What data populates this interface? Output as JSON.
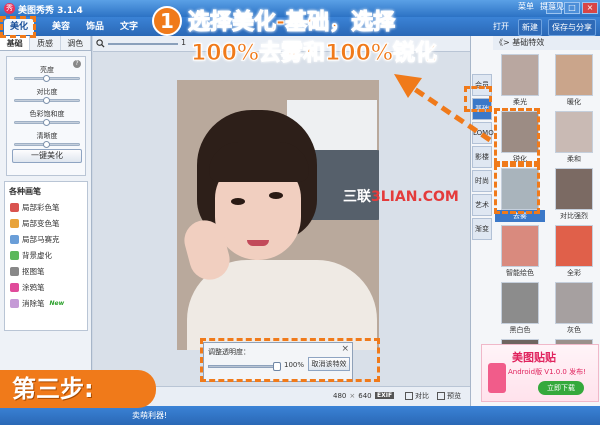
{
  "app": {
    "title": "美图秀秀 3.1.4",
    "logo_char": "秀"
  },
  "window_controls": [
    "–",
    "□",
    "×"
  ],
  "main_tabs": [
    "美化",
    "美容",
    "饰品",
    "文字"
  ],
  "toolbar_right": {
    "menu": "菜单",
    "feedback": "提意见",
    "open": "打开",
    "new": "新建",
    "save_share": "保存与分享"
  },
  "left_panel": {
    "subtabs": [
      "基础",
      "质感",
      "调色"
    ],
    "sliders": [
      "亮度",
      "对比度",
      "色彩饱和度",
      "清晰度"
    ],
    "one_key_button": "一键美化",
    "brush_title": "各种画笔",
    "brushes": [
      {
        "label": "局部彩色笔",
        "icon": "color-brush-icon",
        "color": "#d9534f"
      },
      {
        "label": "局部变色笔",
        "icon": "change-color-brush-icon",
        "color": "#e8a33b"
      },
      {
        "label": "局部马赛克",
        "icon": "mosaic-icon",
        "color": "#6a9ed8"
      },
      {
        "label": "背景虚化",
        "icon": "blur-icon",
        "color": "#5cb85c"
      },
      {
        "label": "抠图笔",
        "icon": "cutout-icon",
        "color": "#888888"
      },
      {
        "label": "涂鸦笔",
        "icon": "doodle-icon",
        "color": "#e04b9a"
      },
      {
        "label": "消除笔",
        "icon": "eraser-icon",
        "color": "#c59ad6",
        "badge": "New"
      }
    ]
  },
  "canvas": {
    "zoom_value": "1",
    "watermark_a": "三联",
    "watermark_b": "3LIAN.COM",
    "opacity_panel": {
      "label": "调整透明度：",
      "value": "100%",
      "cancel_button": "取消该特效",
      "close": "×"
    },
    "width": "480",
    "x": "×",
    "height": "640",
    "exif": "EXIF",
    "compare": "对比",
    "preview": "预览"
  },
  "right_panel": {
    "header": "《> 基础特效",
    "categories": [
      "会员",
      "基础",
      "LOMO",
      "影楼",
      "时尚",
      "艺术",
      "渐变"
    ],
    "active_category": "基础",
    "effects": [
      {
        "name": "柔光",
        "color": "#b9a7a0"
      },
      {
        "name": "暖化",
        "color": "#caa58b"
      },
      {
        "name": "锐化",
        "color": "#9c8c84"
      },
      {
        "name": "柔和",
        "color": "#c9bab4"
      },
      {
        "name": "去雾",
        "color": "#a9b4bc",
        "selected": true
      },
      {
        "name": "对比强烈",
        "color": "#7b6a63"
      },
      {
        "name": "智能绘色",
        "color": "#d98a7e"
      },
      {
        "name": "全彩",
        "color": "#e0604a"
      },
      {
        "name": "黑白色",
        "color": "#8c8c8c"
      },
      {
        "name": "灰色",
        "color": "#a6a0a0"
      },
      {
        "name": "",
        "color": "#6f6560"
      },
      {
        "name": "",
        "color": "#9a908b"
      }
    ],
    "ad": {
      "title": "美图贴贴",
      "subtitle": "Android版 V1.0.0 发布!",
      "download": "立即下载"
    }
  },
  "statusbar": {
    "text": "卖萌利器!"
  },
  "annotation": {
    "step_number": "1",
    "line1": "选择美化-基础，选择",
    "line2": "100%去雾和100%锐化",
    "step_label": "第三步:",
    "accent": "#f07a1a"
  }
}
